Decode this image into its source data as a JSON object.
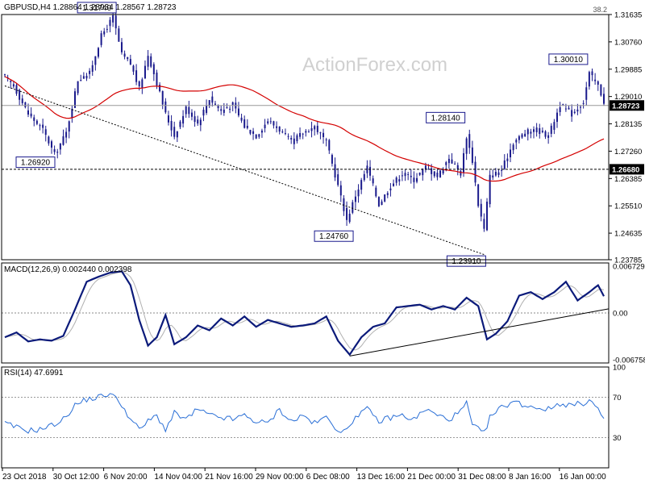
{
  "header": {
    "symbol_line": "GBPUSD,H4  1.28864 1.28934 1.28567 1.28723",
    "watermark": "ActionForex.com"
  },
  "colors": {
    "candle": "#1a1a8c",
    "ma": "#d40000",
    "macd_line": "#0b1a7a",
    "signal": "#b0b0b0",
    "rsi": "#2a6fd6",
    "grid": "#000000"
  },
  "chart_data": [
    {
      "type": "candlestick",
      "name": "price",
      "ylim": [
        1.23785,
        1.31635
      ],
      "y_ticks": [
        "1.31635",
        "1.30760",
        "1.29885",
        "1.29010",
        "1.28135",
        "1.27260",
        "1.26385",
        "1.25510",
        "1.24635",
        "1.23785"
      ],
      "x_ticks": [
        "23 Oct 2018",
        "30 Oct 12:00",
        "6 Nov 20:00",
        "14 Nov 04:00",
        "21 Nov 16:00",
        "29 Nov 00:00",
        "6 Dec 08:00",
        "13 Dec 16:00",
        "21 Dec 00:00",
        "31 Dec 08:00",
        "8 Jan 16:00",
        "16 Jan 00:00"
      ],
      "current_price_label": "1.28723",
      "current_price": 1.28723,
      "hlines": [
        {
          "value": 1.31635,
          "label": "38.2",
          "style": "solid"
        },
        {
          "value": 1.2668,
          "label": "1.26680",
          "style": "dashed"
        },
        {
          "value": 1.28723,
          "label": "",
          "style": "solid-gray"
        }
      ],
      "annotations": [
        {
          "label": "1.31740",
          "index": 37,
          "value": 1.3174
        },
        {
          "label": "1.26920",
          "index": 17,
          "value": 1.2692
        },
        {
          "label": "1.24760",
          "index": 117,
          "value": 1.2476
        },
        {
          "label": "1.28140",
          "index": 158,
          "value": 1.2814
        },
        {
          "label": "1.23910",
          "index": 164,
          "value": 1.2391
        },
        {
          "label": "1.30010",
          "index": 200,
          "value": 1.3001
        }
      ],
      "trendline": {
        "from": {
          "index": 0,
          "value": 1.2935
        },
        "to": {
          "index": 164,
          "value": 1.2395
        }
      },
      "anchors": [
        [
          0,
          1.2965
        ],
        [
          3,
          1.2935
        ],
        [
          8,
          1.2845
        ],
        [
          13,
          1.2795
        ],
        [
          17,
          1.2715
        ],
        [
          21,
          1.2785
        ],
        [
          25,
          1.2955
        ],
        [
          29,
          1.2975
        ],
        [
          33,
          1.3095
        ],
        [
          37,
          1.3155
        ],
        [
          40,
          1.3035
        ],
        [
          43,
          1.3005
        ],
        [
          46,
          1.2925
        ],
        [
          49,
          1.3035
        ],
        [
          52,
          1.2945
        ],
        [
          55,
          1.2845
        ],
        [
          58,
          1.2775
        ],
        [
          62,
          1.2865
        ],
        [
          66,
          1.2815
        ],
        [
          70,
          1.2895
        ],
        [
          74,
          1.2855
        ],
        [
          78,
          1.2875
        ],
        [
          82,
          1.2805
        ],
        [
          86,
          1.2775
        ],
        [
          90,
          1.2825
        ],
        [
          94,
          1.2795
        ],
        [
          98,
          1.2755
        ],
        [
          102,
          1.2785
        ],
        [
          106,
          1.2805
        ],
        [
          110,
          1.2755
        ],
        [
          114,
          1.2615
        ],
        [
          117,
          1.2505
        ],
        [
          120,
          1.2585
        ],
        [
          124,
          1.2675
        ],
        [
          128,
          1.2555
        ],
        [
          132,
          1.2615
        ],
        [
          136,
          1.2655
        ],
        [
          140,
          1.2635
        ],
        [
          144,
          1.2675
        ],
        [
          148,
          1.2645
        ],
        [
          152,
          1.2705
        ],
        [
          156,
          1.2655
        ],
        [
          158,
          1.2775
        ],
        [
          160,
          1.2695
        ],
        [
          162,
          1.2555
        ],
        [
          164,
          1.2475
        ],
        [
          166,
          1.2645
        ],
        [
          170,
          1.2665
        ],
        [
          174,
          1.2755
        ],
        [
          178,
          1.2785
        ],
        [
          182,
          1.2795
        ],
        [
          186,
          1.2775
        ],
        [
          190,
          1.2875
        ],
        [
          194,
          1.2845
        ],
        [
          198,
          1.2885
        ],
        [
          200,
          1.2975
        ],
        [
          203,
          1.2935
        ],
        [
          205,
          1.2885
        ]
      ],
      "ma_period": 55
    },
    {
      "type": "line",
      "name": "MACD(12,26,9) 0.002440 0.002398",
      "header": "MACD(12,26,9) 0.002440 0.002398",
      "ylim": [
        -0.0072,
        0.0072
      ],
      "y_ticks": [
        "0.006729",
        "0.00",
        "-0.006758"
      ],
      "zero_tick": "0.00",
      "trendline": {
        "from": {
          "index": 118,
          "value": -0.0062
        },
        "to": {
          "index": 205,
          "value": 0.0003
        }
      },
      "anchors": [
        [
          0,
          -0.0035
        ],
        [
          4,
          -0.0028
        ],
        [
          8,
          -0.0041
        ],
        [
          12,
          -0.0038
        ],
        [
          16,
          -0.004
        ],
        [
          20,
          -0.0033
        ],
        [
          24,
          0.0005
        ],
        [
          28,
          0.0045
        ],
        [
          32,
          0.0052
        ],
        [
          36,
          0.0058
        ],
        [
          40,
          0.006
        ],
        [
          43,
          0.004
        ],
        [
          46,
          -0.001
        ],
        [
          49,
          -0.0047
        ],
        [
          52,
          -0.0035
        ],
        [
          55,
          -0.0003
        ],
        [
          58,
          -0.0045
        ],
        [
          62,
          -0.0035
        ],
        [
          66,
          -0.0018
        ],
        [
          70,
          -0.0025
        ],
        [
          74,
          -0.0008
        ],
        [
          78,
          -0.0018
        ],
        [
          82,
          -0.0005
        ],
        [
          86,
          -0.002
        ],
        [
          90,
          -0.001
        ],
        [
          94,
          -0.0015
        ],
        [
          98,
          -0.002
        ],
        [
          102,
          -0.0018
        ],
        [
          106,
          -0.0015
        ],
        [
          110,
          -0.0005
        ],
        [
          114,
          -0.004
        ],
        [
          118,
          -0.006
        ],
        [
          122,
          -0.0035
        ],
        [
          126,
          -0.002
        ],
        [
          130,
          -0.0015
        ],
        [
          134,
          0.0008
        ],
        [
          138,
          0.001
        ],
        [
          142,
          0.0012
        ],
        [
          146,
          0.0005
        ],
        [
          150,
          0.001
        ],
        [
          154,
          0.0005
        ],
        [
          158,
          0.0022
        ],
        [
          162,
          0.001
        ],
        [
          165,
          -0.0038
        ],
        [
          168,
          -0.003
        ],
        [
          172,
          -0.0012
        ],
        [
          176,
          0.0025
        ],
        [
          180,
          0.003
        ],
        [
          184,
          0.002
        ],
        [
          188,
          0.003
        ],
        [
          192,
          0.0045
        ],
        [
          196,
          0.0018
        ],
        [
          200,
          0.003
        ],
        [
          203,
          0.004
        ],
        [
          205,
          0.0024
        ]
      ],
      "signal_lag": 4
    },
    {
      "type": "line",
      "name": "RSI(14) 47.6991",
      "header": "RSI(14) 47.6991",
      "ylim": [
        0,
        100
      ],
      "y_ticks": [
        "100",
        "70",
        "30",
        "0"
      ],
      "levels": [
        70,
        30
      ],
      "anchors": [
        [
          0,
          44
        ],
        [
          4,
          40
        ],
        [
          8,
          37
        ],
        [
          12,
          38
        ],
        [
          16,
          42
        ],
        [
          20,
          48
        ],
        [
          24,
          62
        ],
        [
          28,
          68
        ],
        [
          32,
          70
        ],
        [
          36,
          74
        ],
        [
          40,
          63
        ],
        [
          43,
          48
        ],
        [
          46,
          38
        ],
        [
          49,
          46
        ],
        [
          52,
          52
        ],
        [
          55,
          38
        ],
        [
          58,
          54
        ],
        [
          62,
          48
        ],
        [
          66,
          58
        ],
        [
          70,
          52
        ],
        [
          74,
          50
        ],
        [
          78,
          48
        ],
        [
          82,
          52
        ],
        [
          86,
          46
        ],
        [
          90,
          44
        ],
        [
          94,
          58
        ],
        [
          98,
          46
        ],
        [
          102,
          52
        ],
        [
          106,
          44
        ],
        [
          110,
          50
        ],
        [
          114,
          38
        ],
        [
          117,
          36
        ],
        [
          120,
          52
        ],
        [
          124,
          58
        ],
        [
          128,
          46
        ],
        [
          132,
          50
        ],
        [
          136,
          52
        ],
        [
          140,
          48
        ],
        [
          144,
          58
        ],
        [
          148,
          52
        ],
        [
          152,
          48
        ],
        [
          156,
          56
        ],
        [
          158,
          64
        ],
        [
          160,
          42
        ],
        [
          164,
          34
        ],
        [
          166,
          50
        ],
        [
          170,
          60
        ],
        [
          174,
          66
        ],
        [
          178,
          62
        ],
        [
          182,
          60
        ],
        [
          186,
          58
        ],
        [
          190,
          64
        ],
        [
          194,
          62
        ],
        [
          198,
          64
        ],
        [
          200,
          68
        ],
        [
          203,
          58
        ],
        [
          205,
          48
        ]
      ]
    }
  ]
}
